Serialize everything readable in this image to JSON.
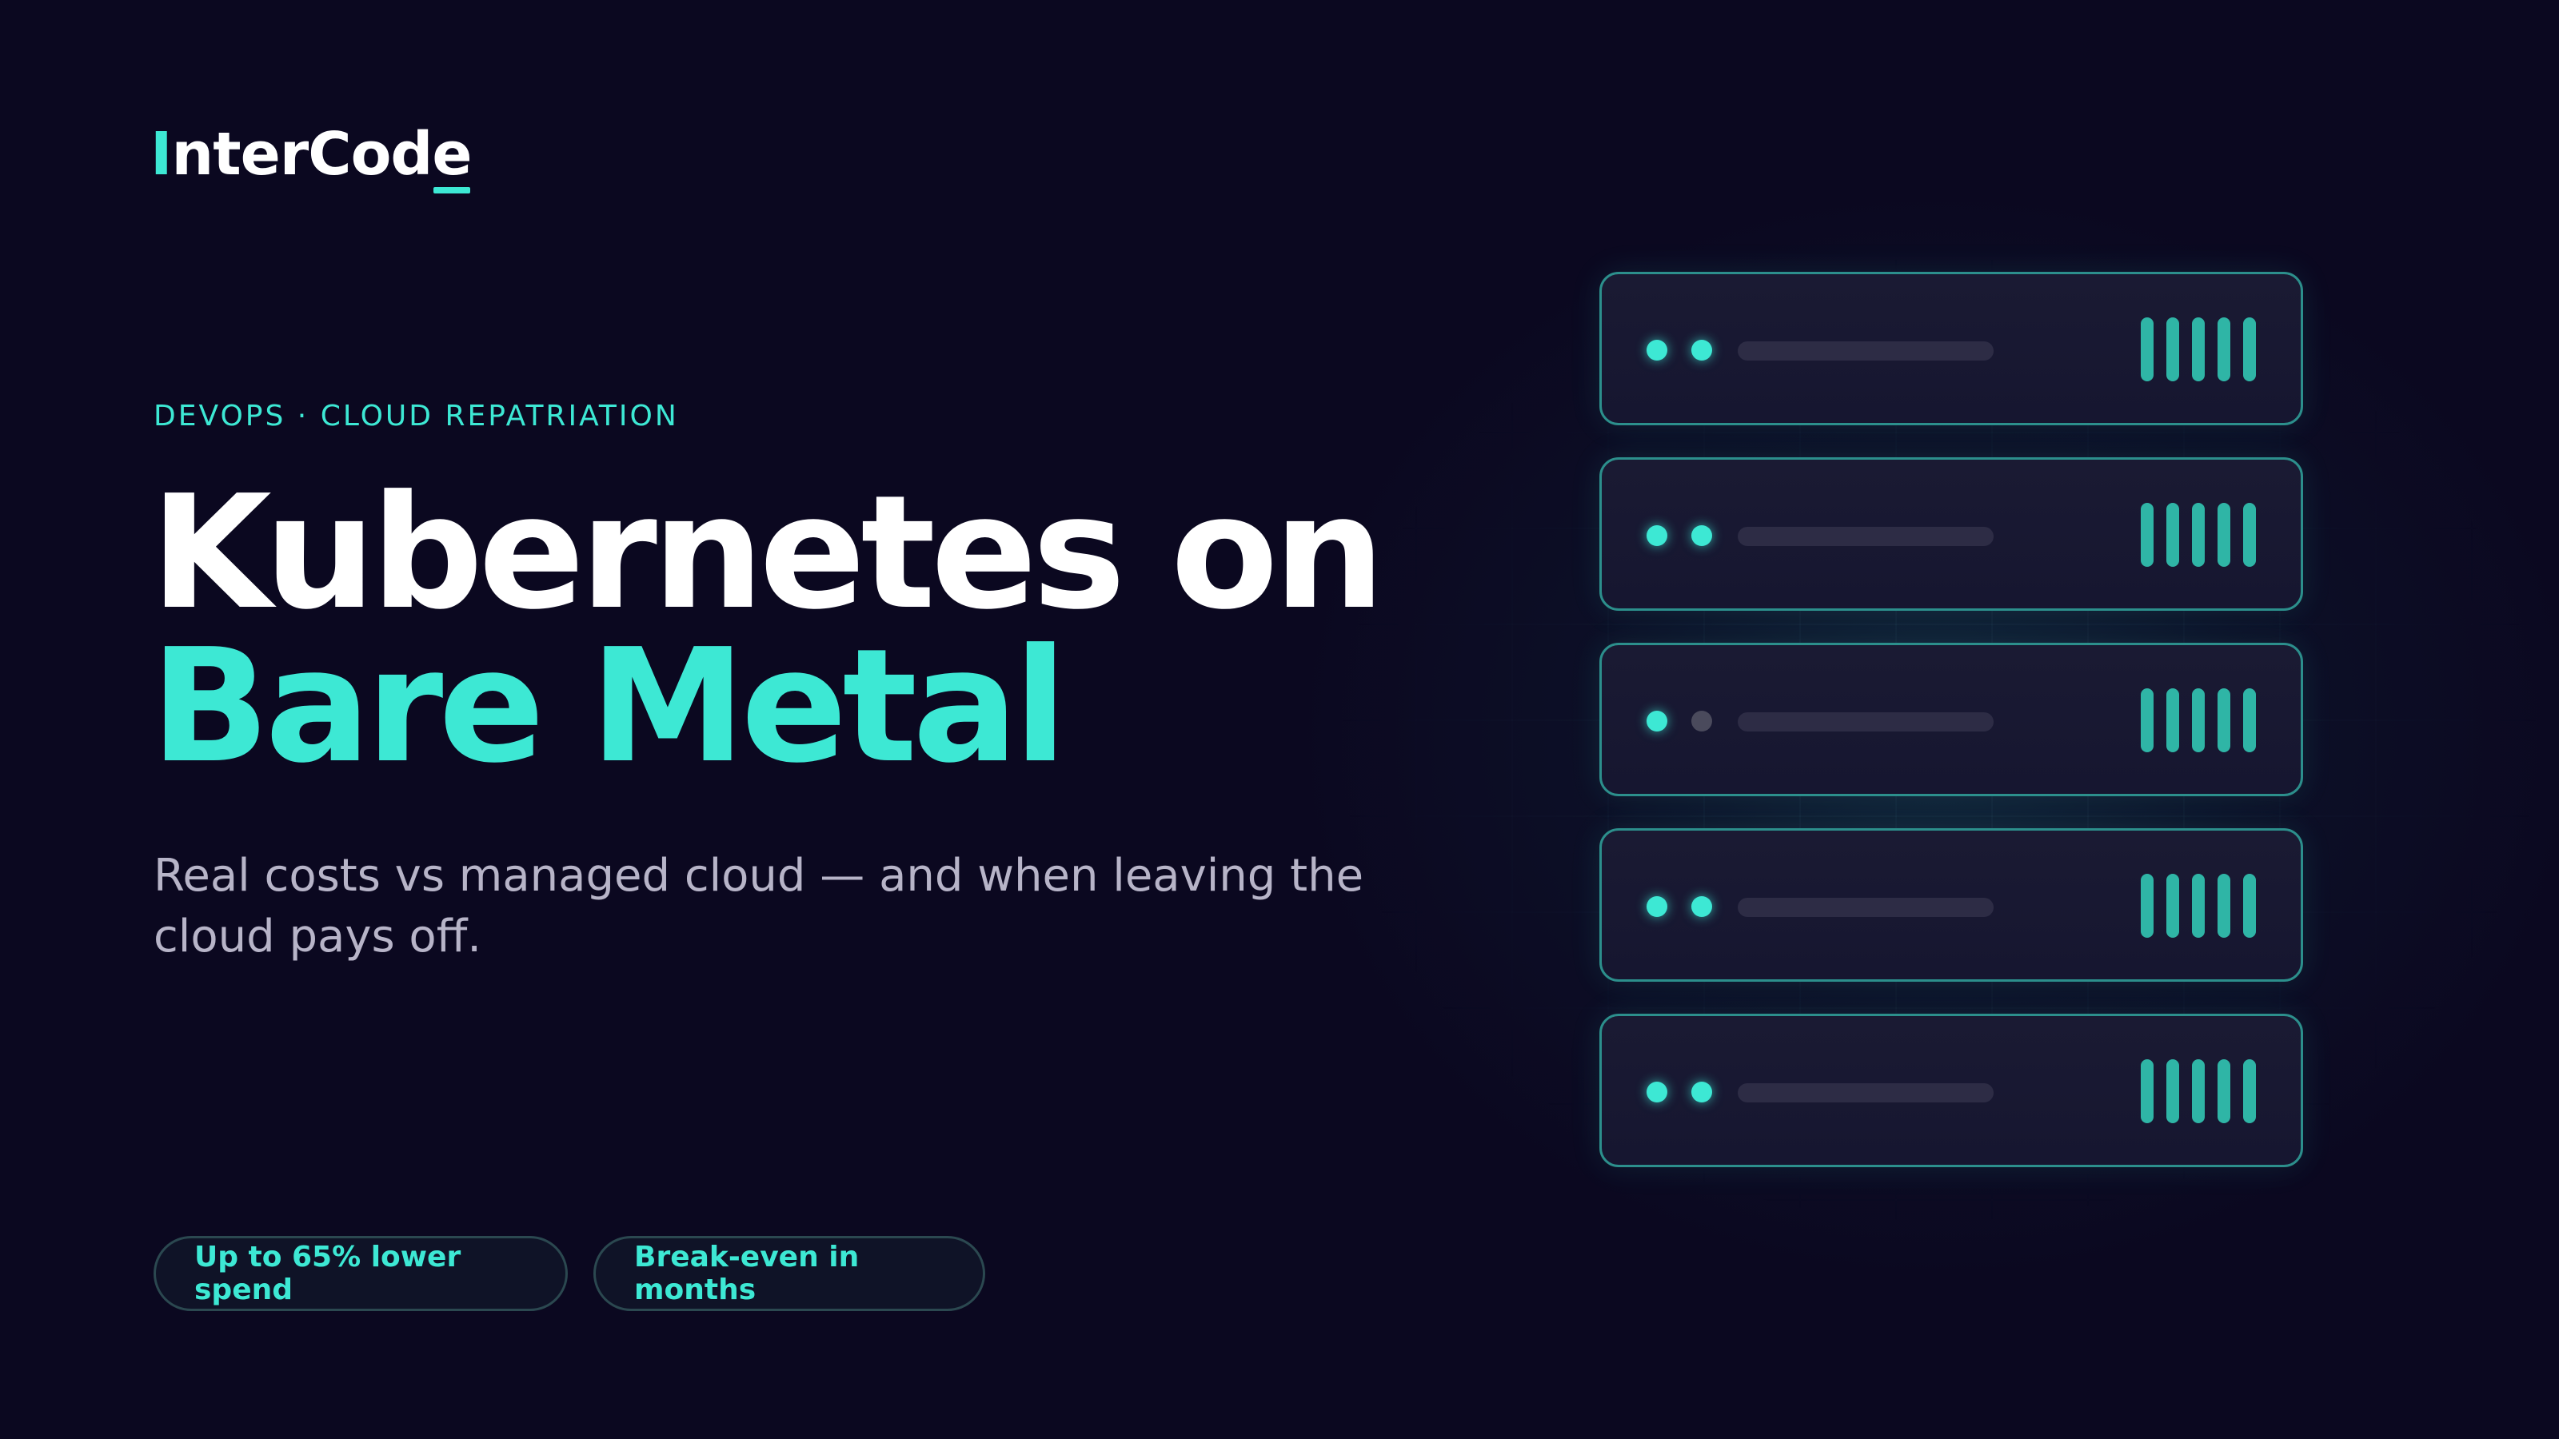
{
  "brand": {
    "logo_first": "I",
    "logo_middle": "nterCod",
    "logo_last": "e",
    "accent_color": "#3de8d4",
    "background_color": "#0b0820"
  },
  "hero": {
    "eyebrow": "DEVOPS · CLOUD REPATRIATION",
    "title_line1": "Kubernetes on",
    "title_line2": "Bare Metal",
    "subtitle": "Real costs vs managed cloud — and when leaving the cloud pays off."
  },
  "pills": [
    {
      "label": "Up to 65% lower spend"
    },
    {
      "label": "Break-even in months"
    }
  ],
  "server_rack": {
    "units": [
      {
        "indicator_1": "on",
        "indicator_2": "on"
      },
      {
        "indicator_1": "on",
        "indicator_2": "on"
      },
      {
        "indicator_1": "on",
        "indicator_2": "off"
      },
      {
        "indicator_1": "on",
        "indicator_2": "on"
      },
      {
        "indicator_1": "on",
        "indicator_2": "on"
      }
    ],
    "icon": "server-rack-icon"
  }
}
